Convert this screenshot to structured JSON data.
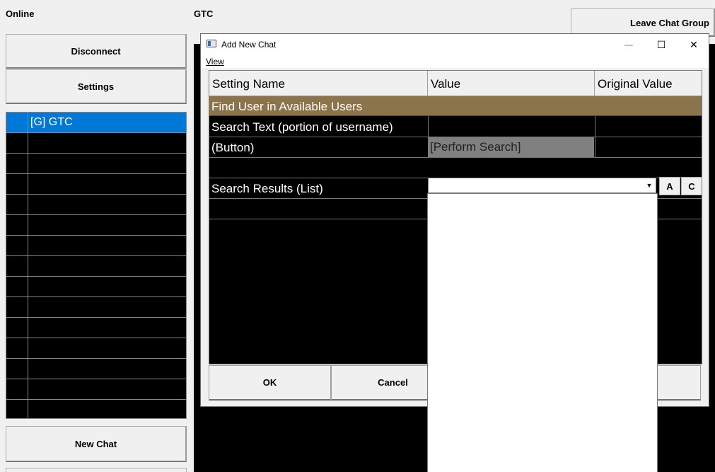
{
  "status": {
    "online": "Online",
    "group": "GTC"
  },
  "left": {
    "disconnect": "Disconnect",
    "settings": "Settings",
    "new_chat": "New Chat",
    "chats": [
      "[G] GTC"
    ]
  },
  "top_right": {
    "leave_chat_group": "Leave Chat Group"
  },
  "dialog": {
    "title": "Add New Chat",
    "menu": {
      "view": "View"
    },
    "window_controls": {
      "minimize": "—",
      "maximize": "☐",
      "close": "✕"
    },
    "grid": {
      "headers": [
        "Setting Name",
        "Value",
        "Original Value"
      ],
      "section": "Find User in Available Users",
      "rows": {
        "search_text": "Search Text (portion of username)",
        "button_label": " (Button)",
        "perform_search": "[Perform Search]",
        "search_results": "Search Results (List)"
      },
      "combo_arrow": "▼",
      "btn_a": "A",
      "btn_c": "C"
    },
    "buttons": {
      "ok": "OK",
      "cancel": "Cancel"
    }
  },
  "colors": {
    "section_bg": "#8b734c",
    "selection": "#0078d7",
    "grid_bg": "#000000"
  }
}
